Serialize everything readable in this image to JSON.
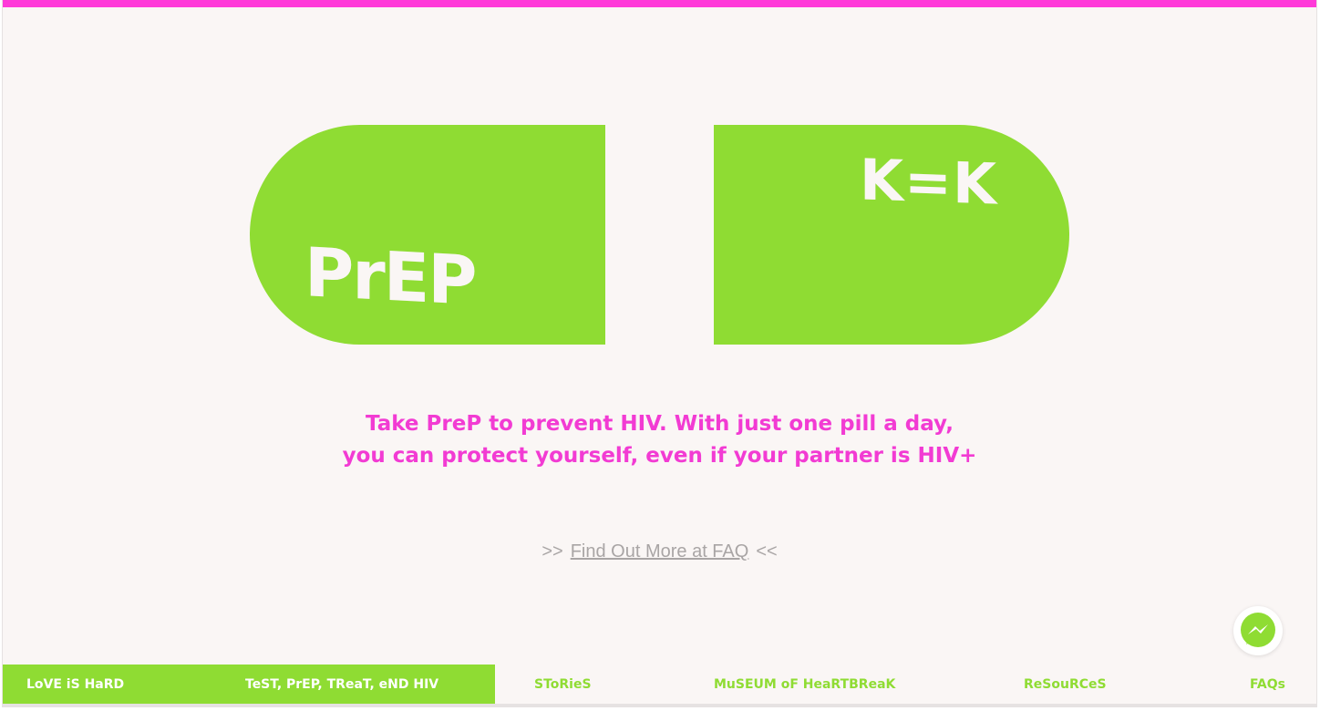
{
  "colors": {
    "accent_magenta": "#ff3ad9",
    "accent_green": "#8fdc33",
    "background": "#faf6f5",
    "muted_text": "#a9a5a5"
  },
  "hero": {
    "pill_left_text": "PrEP",
    "pill_right_text": "K=K"
  },
  "tagline": {
    "line1": "Take PreP to prevent HIV. With just one pill a day,",
    "line2": "you can protect yourself, even if your partner is HIV+"
  },
  "faq_link": {
    "prefix": ">>",
    "label": "Find Out More at FAQ",
    "suffix": "<<"
  },
  "messenger": {
    "icon": "messenger-icon"
  },
  "nav": {
    "items": [
      {
        "label": "LoVE iS HaRD",
        "active": true
      },
      {
        "label": "TeST, PrEP, TReaT, eND HIV",
        "active": true
      },
      {
        "label": "SToRieS",
        "active": false
      },
      {
        "label": "MuSEUM oF HeaRTBReaK",
        "active": false
      },
      {
        "label": "ReSouRCeS",
        "active": false
      },
      {
        "label": "FAQs",
        "active": false
      }
    ]
  }
}
